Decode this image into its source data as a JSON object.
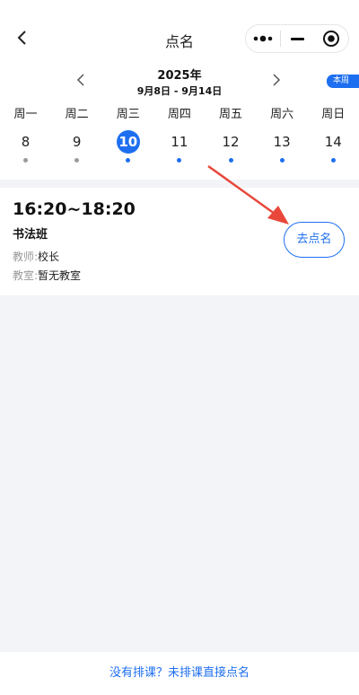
{
  "nav": {
    "title": "点名"
  },
  "week": {
    "year": "2025年",
    "range": "9月8日 - 9月14日",
    "this_week_label": "本周",
    "days": [
      {
        "weekday": "周一",
        "date": "8",
        "selected": false,
        "dot": "past"
      },
      {
        "weekday": "周二",
        "date": "9",
        "selected": false,
        "dot": "past"
      },
      {
        "weekday": "周三",
        "date": "10",
        "selected": true,
        "dot": "active"
      },
      {
        "weekday": "周四",
        "date": "11",
        "selected": false,
        "dot": "active"
      },
      {
        "weekday": "周五",
        "date": "12",
        "selected": false,
        "dot": "active"
      },
      {
        "weekday": "周六",
        "date": "13",
        "selected": false,
        "dot": "active"
      },
      {
        "weekday": "周日",
        "date": "14",
        "selected": false,
        "dot": "active"
      }
    ]
  },
  "lesson": {
    "time": "16:20~18:20",
    "class_name": "书法班",
    "teacher_label": "教师:",
    "teacher": "校长",
    "room_label": "教室:",
    "room": "暂无教室",
    "action_label": "去点名"
  },
  "footer": {
    "link_label": "没有排课？未排课直接点名"
  },
  "colors": {
    "accent": "#1e6ff0",
    "annotation_arrow": "#e8473a",
    "past_dot": "#9a9a9a"
  }
}
